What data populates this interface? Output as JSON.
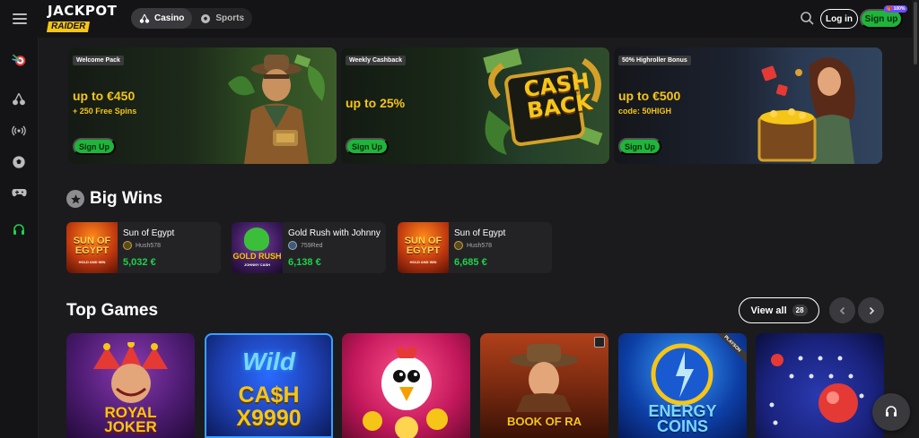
{
  "header": {
    "logo_top": "JACKPOT",
    "logo_bottom": "RAIDER",
    "tabs": [
      {
        "label": "Casino",
        "icon": "cherries-icon",
        "active": true
      },
      {
        "label": "Sports",
        "icon": "soccer-ball-icon",
        "active": false
      }
    ],
    "login_label": "Log in",
    "signup_label": "Sign up",
    "signup_badge": "🎁 100%"
  },
  "sidebar": {
    "icons": [
      "target-darts-icon",
      "cherries-icon",
      "live-broadcast-icon",
      "soccer-ball-icon",
      "gamepad-icon",
      "headset-icon"
    ]
  },
  "banners": [
    {
      "tag": "Welcome Pack",
      "headline": "up to €450",
      "subline": "+ 250 Free Spins",
      "button": "Sign Up"
    },
    {
      "tag": "Weekly Cashback",
      "headline": "up to 25%",
      "subline": "",
      "button": "Sign Up",
      "art_text_1": "CASH",
      "art_text_2": "BACK"
    },
    {
      "tag": "50% Highroller Bonus",
      "headline": "up to €500",
      "subline": "code: 50HIGH",
      "button": "Sign Up"
    }
  ],
  "big_wins": {
    "title": "Big Wins",
    "items": [
      {
        "game": "Sun of Egypt",
        "user": "Hush578",
        "amount": "5,032 €",
        "thumb_text": "SUN OF EGYPT",
        "thumb_sub": "HOLD AND WIN"
      },
      {
        "game": "Gold Rush with Johnny Cash",
        "user": "759Red",
        "amount": "6,138 €",
        "thumb_text": "GOLD RUSH",
        "thumb_sub": "JOHNNY CASH"
      },
      {
        "game": "Sun of Egypt",
        "user": "Hush578",
        "amount": "6,685 €",
        "thumb_text": "SUN OF EGYPT",
        "thumb_sub": "HOLD AND WIN"
      }
    ]
  },
  "top_games": {
    "title": "Top Games",
    "view_all_label": "View all",
    "view_all_count": "28",
    "games": [
      {
        "name_line1": "ROYAL",
        "name_line2": "JOKER",
        "badge": "",
        "color": "#4a1a6e"
      },
      {
        "name_line1": "Wild",
        "name_line2": "CA$H X9990",
        "badge": "",
        "color": "#1e3fb0"
      },
      {
        "name_line1": "",
        "name_line2": "",
        "badge": "",
        "color": "#c2185b"
      },
      {
        "name_line1": "BOOK OF RA",
        "name_line2": "",
        "badge": "",
        "color": "#8a2a10"
      },
      {
        "name_line1": "ENERGY",
        "name_line2": "COINS",
        "badge": "PLAYSON",
        "color": "#0d3fa6"
      },
      {
        "name_line1": "",
        "name_line2": "",
        "badge": "",
        "color": "#1a237e"
      }
    ]
  }
}
